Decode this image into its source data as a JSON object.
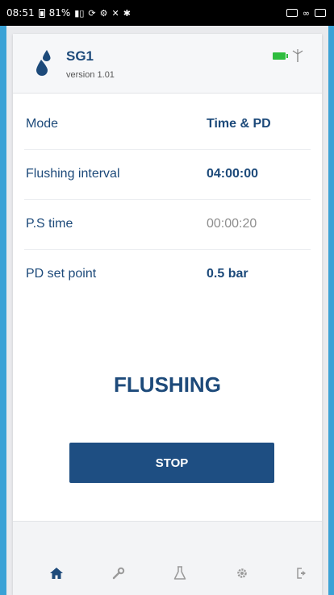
{
  "status_bar": {
    "time": "08:51",
    "battery_percent": "81%"
  },
  "device": {
    "name": "SG1",
    "version": "version 1.01"
  },
  "settings": [
    {
      "label": "Mode",
      "value": "Time & PD",
      "muted": false
    },
    {
      "label": "Flushing interval",
      "value": "04:00:00",
      "muted": false
    },
    {
      "label": "P.S time",
      "value": "00:00:20",
      "muted": true
    },
    {
      "label": "PD set point",
      "value": "0.5 bar",
      "muted": false
    }
  ],
  "status": "FLUSHING",
  "stop_label": "STOP",
  "nav": {
    "items": [
      "home-icon",
      "wrench-icon",
      "flask-icon",
      "gear-icon",
      "logout-icon"
    ],
    "active": "home-icon"
  },
  "colors": {
    "primary": "#1e4e82",
    "text": "#1d4a7a",
    "frame": "#3aa2d6",
    "battery": "#2ebd3e",
    "muted": "#8e8e8e"
  }
}
